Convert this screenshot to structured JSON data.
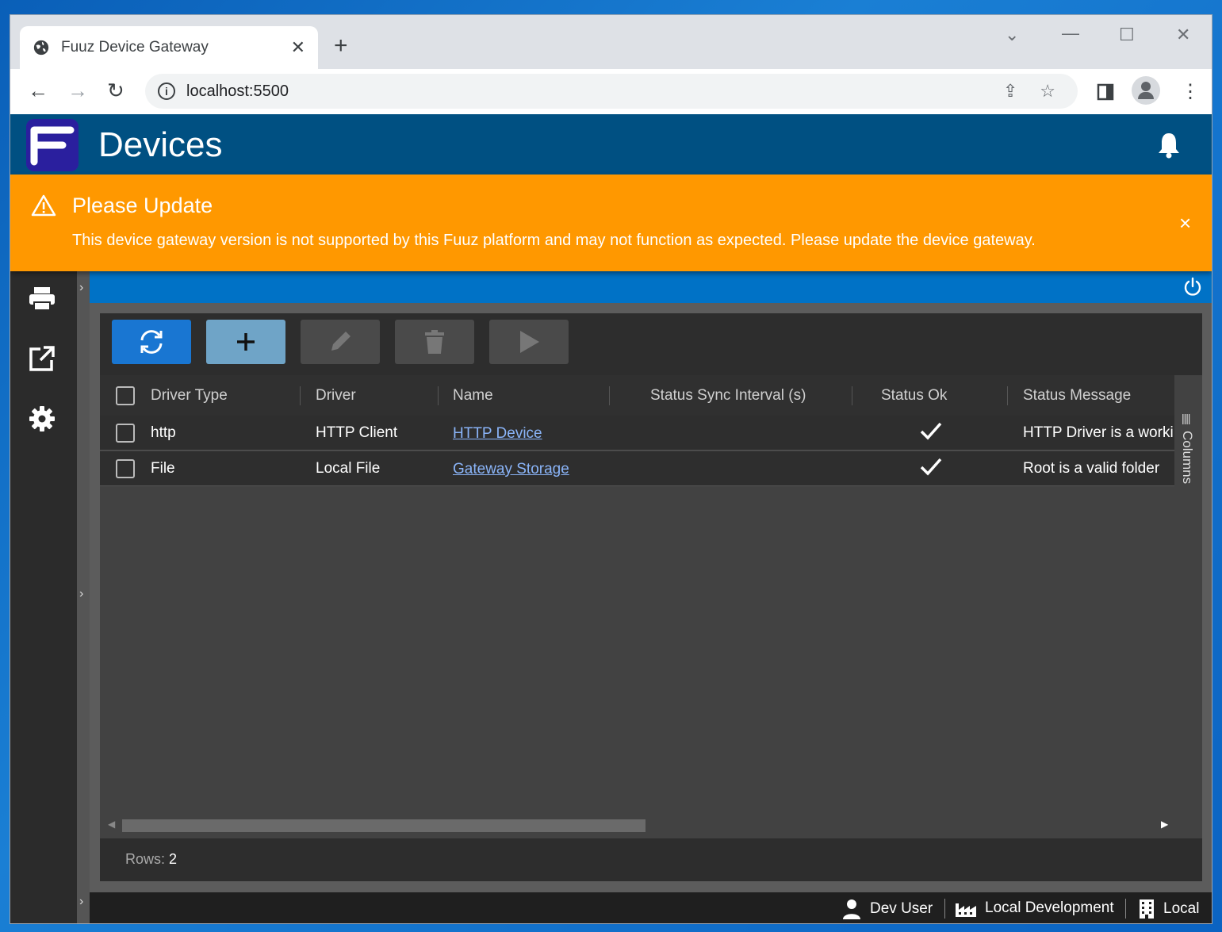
{
  "browser": {
    "tab_title": "Fuuz Device Gateway",
    "new_tab": "+",
    "url": "localhost:5500"
  },
  "app": {
    "title": "Devices",
    "brand_color": "#005082",
    "accent_color": "#0072c6"
  },
  "banner": {
    "title": "Please Update",
    "message": "This device gateway version is not supported by this Fuuz platform and may not function as expected. Please update the device gateway.",
    "close": "×",
    "color": "#ff9800"
  },
  "sidebar": {
    "items": [
      {
        "icon": "printer-icon"
      },
      {
        "icon": "external-link-icon"
      },
      {
        "icon": "gear-icon"
      }
    ]
  },
  "toolbar": {
    "buttons": [
      {
        "icon": "refresh-icon",
        "enabled": true
      },
      {
        "icon": "add-icon",
        "enabled": true
      },
      {
        "icon": "edit-icon",
        "enabled": false
      },
      {
        "icon": "delete-icon",
        "enabled": false
      },
      {
        "icon": "run-icon",
        "enabled": false
      }
    ]
  },
  "grid": {
    "columns": [
      "Driver Type",
      "Driver",
      "Name",
      "Status Sync Interval (s)",
      "Status Ok",
      "Status Message"
    ],
    "rows": [
      {
        "driver_type": "http",
        "driver": "HTTP Client",
        "name": "HTTP Device",
        "status_sync_interval": "",
        "status_ok": true,
        "status_message": "HTTP Driver is a worki"
      },
      {
        "driver_type": "File",
        "driver": "Local File",
        "name": "Gateway Storage",
        "status_sync_interval": "",
        "status_ok": true,
        "status_message": "Root is a valid folder"
      }
    ],
    "columns_panel_label": "Columns",
    "rows_label": "Rows:",
    "rows_count": "2"
  },
  "statusbar": {
    "user": "Dev User",
    "tenant": "Local Development",
    "environment": "Local"
  }
}
